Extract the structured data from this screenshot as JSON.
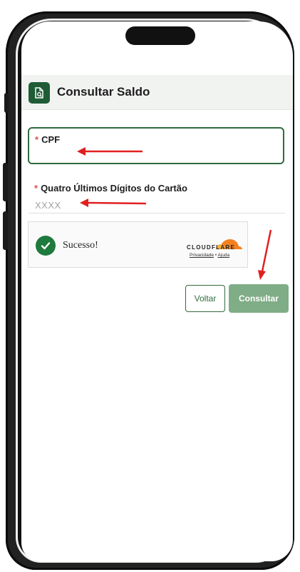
{
  "header": {
    "title": "Consultar Saldo",
    "icon": "document-search-icon",
    "icon_bg": "#1f5c36"
  },
  "form": {
    "cpf": {
      "required_mark": "*",
      "label": "CPF",
      "value": ""
    },
    "card_digits": {
      "required_mark": "*",
      "label": "Quatro Últimos Dígitos do Cartão",
      "placeholder": "XXXX",
      "value": ""
    }
  },
  "captcha": {
    "status": "Sucesso!",
    "provider": "CLOUDFLARE",
    "links": {
      "privacy": "Privacidade",
      "separator": "•",
      "help": "Ajuda"
    },
    "status_color": "#1e7a3d",
    "brand_color": "#f48120"
  },
  "actions": {
    "back_label": "Voltar",
    "submit_label": "Consultar",
    "primary_color": "#7fad86",
    "accent_color": "#2f6b3e"
  },
  "annotations": {
    "arrow_color": "#e02020"
  }
}
